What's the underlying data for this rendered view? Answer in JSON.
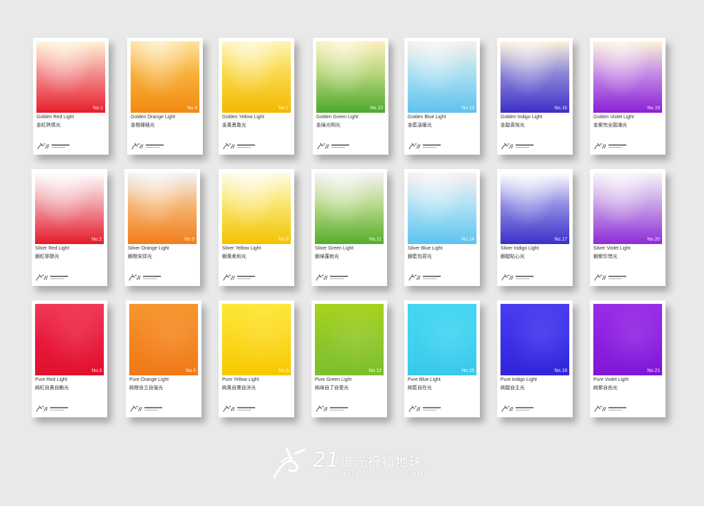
{
  "cards": [
    {
      "en": "Golden Red Light",
      "zh": "金紅熱情光",
      "num": "No.1",
      "type": "golden",
      "colors": {
        "top": "#fff3d2",
        "mid": "#f28e8e",
        "bottom": "#e61e2b"
      }
    },
    {
      "en": "Golden Orange Light",
      "zh": "金橙穩極光",
      "num": "No.4",
      "type": "golden",
      "colors": {
        "top": "#fde3a0",
        "mid": "#f7b13c",
        "bottom": "#f28a10"
      }
    },
    {
      "en": "Golden Yellow Light",
      "zh": "金黃勇敢光",
      "num": "No.7",
      "type": "golden",
      "colors": {
        "top": "#fff4b6",
        "mid": "#f9d84a",
        "bottom": "#f4b800"
      }
    },
    {
      "en": "Golden Green Light",
      "zh": "金綠光明光",
      "num": "No.10",
      "type": "golden",
      "colors": {
        "top": "#fdf0bf",
        "mid": "#b7d67a",
        "bottom": "#4ca92e"
      }
    },
    {
      "en": "Golden Blue Light",
      "zh": "金藍溫暖光",
      "num": "No.13",
      "type": "golden",
      "colors": {
        "top": "#f5f0e6",
        "mid": "#a9dff2",
        "bottom": "#5ec2ef"
      }
    },
    {
      "en": "Golden Indigo Light",
      "zh": "金靛喜悅光",
      "num": "No.16",
      "type": "golden",
      "colors": {
        "top": "#fbf2d6",
        "mid": "#8c87d8",
        "bottom": "#3d2fc6"
      }
    },
    {
      "en": "Golden Violet Light",
      "zh": "金紫完全圓滿光",
      "num": "No.19",
      "type": "golden",
      "colors": {
        "top": "#fcf3d9",
        "mid": "#c58be6",
        "bottom": "#8a1fd6"
      }
    },
    {
      "en": "Silver Red Light",
      "zh": "銀紅寧靜光",
      "num": "No.2",
      "type": "silver",
      "colors": {
        "top": "#ffffff",
        "mid": "#f09ca5",
        "bottom": "#e5192a"
      }
    },
    {
      "en": "Silver Orange Light",
      "zh": "銀橙安詳光",
      "num": "No.5",
      "type": "silver",
      "colors": {
        "top": "#f1f4fa",
        "mid": "#f5b573",
        "bottom": "#f27e1a"
      }
    },
    {
      "en": "Silver Yellow Light",
      "zh": "銀黃柔和光",
      "num": "No.8",
      "type": "silver",
      "colors": {
        "top": "#fffbe6",
        "mid": "#f9e56c",
        "bottom": "#f3c300"
      }
    },
    {
      "en": "Silver Green Light",
      "zh": "銀綠蓬勃光",
      "num": "No.11",
      "type": "silver",
      "colors": {
        "top": "#f4f4f4",
        "mid": "#b9d98a",
        "bottom": "#56ad2a"
      }
    },
    {
      "en": "Silver Blue Light",
      "zh": "銀藍包容光",
      "num": "No.14",
      "type": "silver",
      "colors": {
        "top": "#fbeef0",
        "mid": "#aee2f5",
        "bottom": "#5dc3ef"
      }
    },
    {
      "en": "Silver Indigo Light",
      "zh": "銀靛貼心光",
      "num": "No.17",
      "type": "silver",
      "colors": {
        "top": "#ffffff",
        "mid": "#8f8ce2",
        "bottom": "#3a30c8"
      }
    },
    {
      "en": "Silver Violet Light",
      "zh": "銀紫珍惜光",
      "num": "No.20",
      "type": "silver",
      "colors": {
        "top": "#f8f4fb",
        "mid": "#c79fe6",
        "bottom": "#8d2bd8"
      }
    },
    {
      "en": "Pure Red Light",
      "zh": "純紅自責自勵光",
      "num": "No.3",
      "type": "pure",
      "colors": {
        "top": "#f03a58",
        "mid": "#e8183a",
        "bottom": "#e0102e"
      }
    },
    {
      "en": "Pure Orange Light",
      "zh": "純橙自立自強光",
      "num": "No.6",
      "type": "pure",
      "colors": {
        "top": "#f7962f",
        "mid": "#f38420",
        "bottom": "#f07a18"
      }
    },
    {
      "en": "Pure Yellow Light",
      "zh": "純黃自覺自決光",
      "num": "No.9",
      "type": "pure",
      "colors": {
        "top": "#fde83a",
        "mid": "#fbd61a",
        "bottom": "#f7c800"
      }
    },
    {
      "en": "Pure Green Light",
      "zh": "純綠自了自愛光",
      "num": "No.12",
      "type": "pure",
      "colors": {
        "top": "#a6d31c",
        "mid": "#8dc52a",
        "bottom": "#7dbf2e"
      }
    },
    {
      "en": "Pure Blue Light",
      "zh": "純藍自在光",
      "num": "No.15",
      "type": "pure",
      "colors": {
        "top": "#44d6f2",
        "mid": "#3fd1f0",
        "bottom": "#3ac8ec"
      }
    },
    {
      "en": "Pure Indigo Light",
      "zh": "純靛自主光",
      "num": "No.18",
      "type": "pure",
      "colors": {
        "top": "#4a3df0",
        "mid": "#3a2fe8",
        "bottom": "#3225d8"
      }
    },
    {
      "en": "Pure Violet Light",
      "zh": "純紫自由光",
      "num": "No.21",
      "type": "pure",
      "colors": {
        "top": "#9a2ee6",
        "mid": "#8b1fe0",
        "bottom": "#7f16d6"
      }
    }
  ],
  "brand": {
    "number": "21",
    "title_zh": "道光祝福地球",
    "title_en": "Lights Bless the Earth",
    "color": "#ffffff"
  }
}
